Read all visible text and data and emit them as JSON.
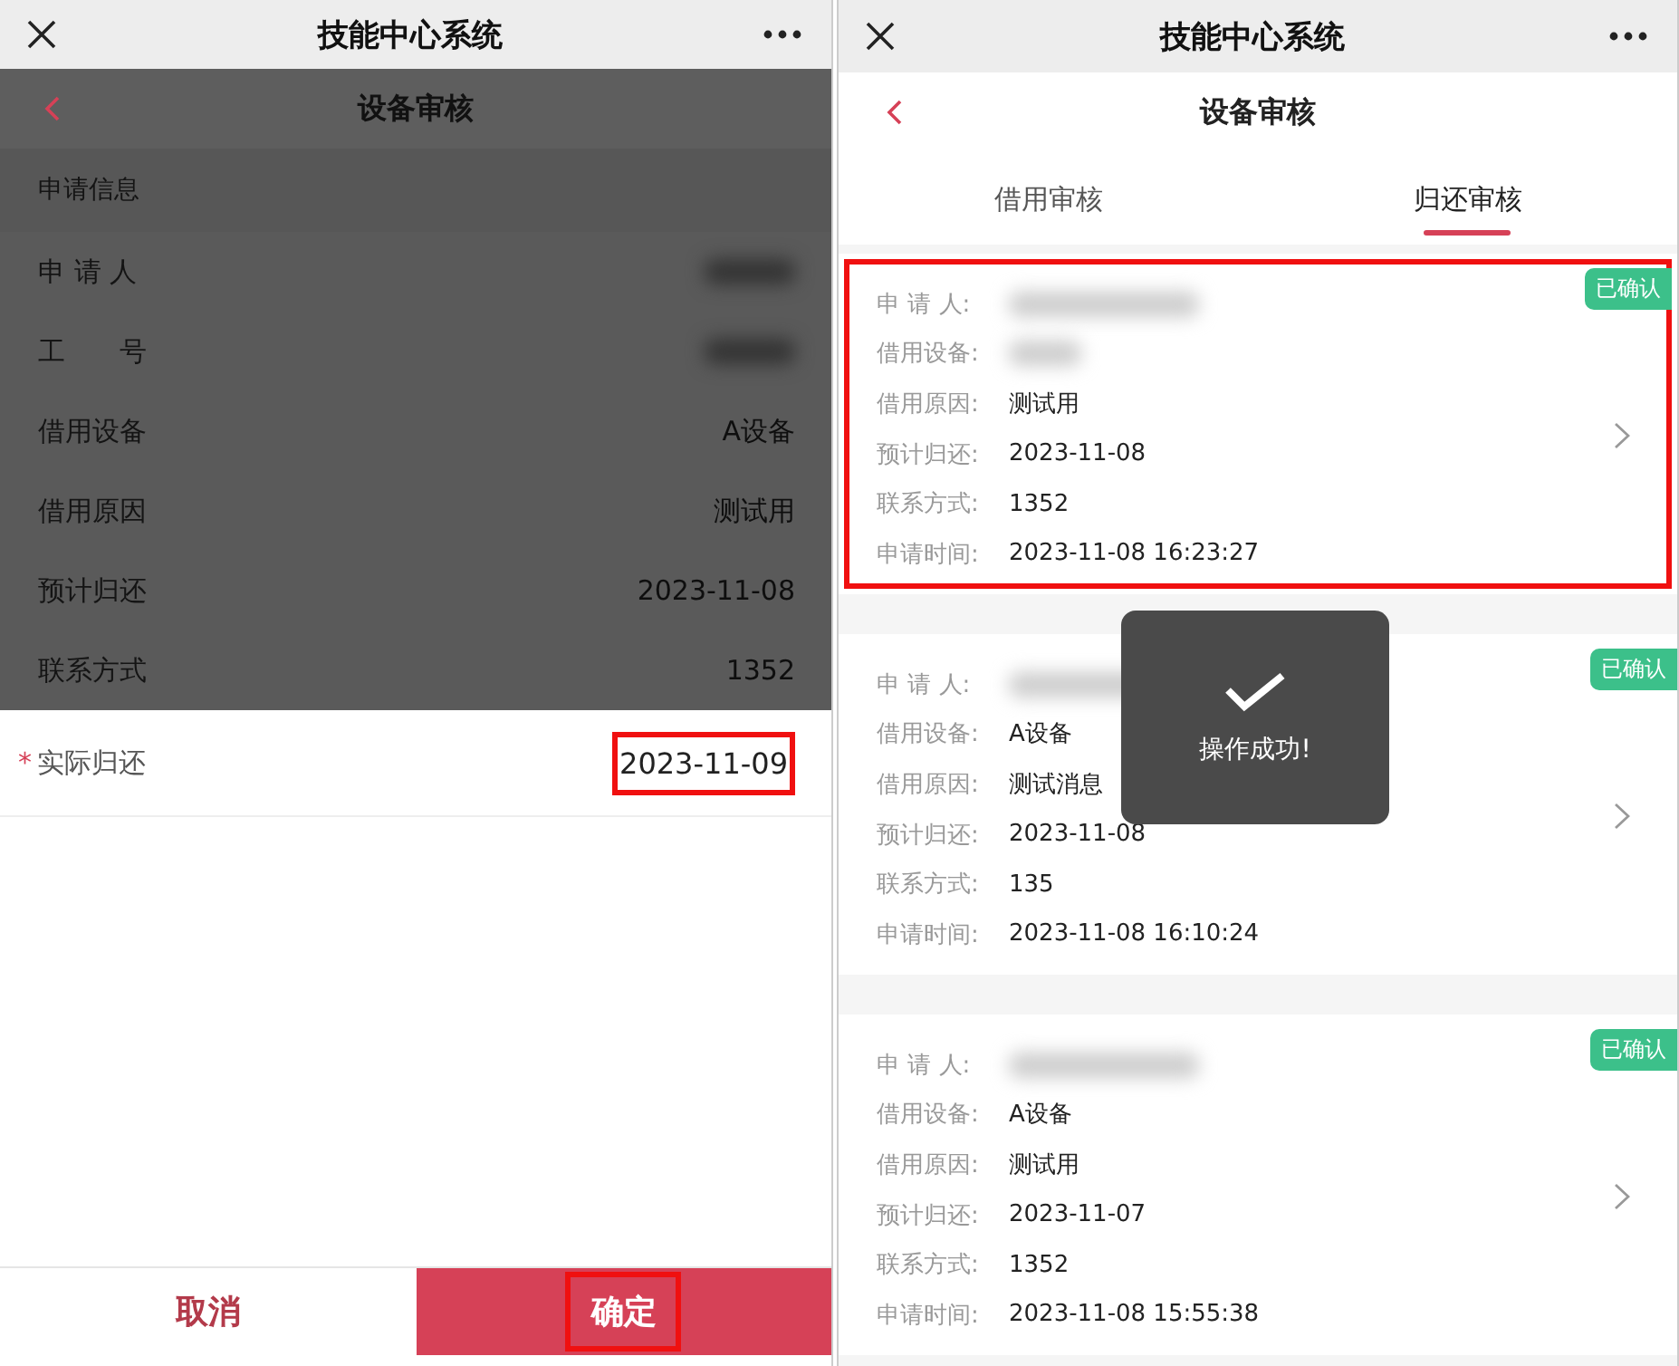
{
  "left_screen": {
    "app_bar": {
      "title": "技能中心系统"
    },
    "page_header": {
      "title": "设备审核"
    },
    "dimmed": true,
    "section_title": "申请信息",
    "fields": [
      {
        "label": "申 请 人",
        "redacted": true
      },
      {
        "label": "工　　号",
        "redacted": true
      },
      {
        "label": "借用设备",
        "value": "A设备",
        "redacted": false
      },
      {
        "label": "借用原因",
        "value": "测试用",
        "redacted": false
      },
      {
        "label": "预计归还",
        "value": "2023-11-08",
        "redacted": false
      },
      {
        "label": "联系方式",
        "value": "1352",
        "redacted": false
      }
    ],
    "return_field": {
      "label": "实际归还",
      "required_mark": "*",
      "value": "2023-11-09",
      "highlighted": true
    },
    "buttons": [
      {
        "label": "取消",
        "kind": "secondary",
        "highlighted": false
      },
      {
        "label": "确定",
        "kind": "primary",
        "highlighted": true
      }
    ]
  },
  "right_screen": {
    "app_bar": {
      "title": "技能中心系统"
    },
    "page_header": {
      "title": "设备审核"
    },
    "tabs": [
      {
        "label": "借用审核",
        "selected": false
      },
      {
        "label": "归还审核",
        "selected": true
      }
    ],
    "cards": [
      {
        "status": "已确认",
        "highlighted": true,
        "fields": [
          {
            "label": "申 请 人:",
            "redacted": true
          },
          {
            "label": "借用设备:",
            "redacted": true
          },
          {
            "label": "借用原因:",
            "value": "测试用",
            "redacted": false
          },
          {
            "label": "预计归还:",
            "value": "2023-11-08",
            "redacted": false
          },
          {
            "label": "联系方式:",
            "value": "1352",
            "redacted": false
          },
          {
            "label": "申请时间:",
            "value": "2023-11-08 16:23:27",
            "redacted": false
          }
        ]
      },
      {
        "status": "已确认",
        "highlighted": false,
        "fields": [
          {
            "label": "申 请 人:",
            "redacted": true
          },
          {
            "label": "借用设备:",
            "value": "A设备",
            "redacted": false
          },
          {
            "label": "借用原因:",
            "value": "测试消息",
            "redacted": false
          },
          {
            "label": "预计归还:",
            "value": "2023-11-08",
            "redacted": false
          },
          {
            "label": "联系方式:",
            "value": "135",
            "redacted": false
          },
          {
            "label": "申请时间:",
            "value": "2023-11-08 16:10:24",
            "redacted": false
          }
        ]
      },
      {
        "status": "已确认",
        "highlighted": false,
        "fields": [
          {
            "label": "申 请 人:",
            "redacted": true
          },
          {
            "label": "借用设备:",
            "value": "A设备",
            "redacted": false
          },
          {
            "label": "借用原因:",
            "value": "测试用",
            "redacted": false
          },
          {
            "label": "预计归还:",
            "value": "2023-11-07",
            "redacted": false
          },
          {
            "label": "联系方式:",
            "value": "1352",
            "redacted": false
          },
          {
            "label": "申请时间:",
            "value": "2023-11-08 15:55:38",
            "redacted": false
          }
        ]
      }
    ],
    "toast": {
      "message": "操作成功!"
    }
  }
}
